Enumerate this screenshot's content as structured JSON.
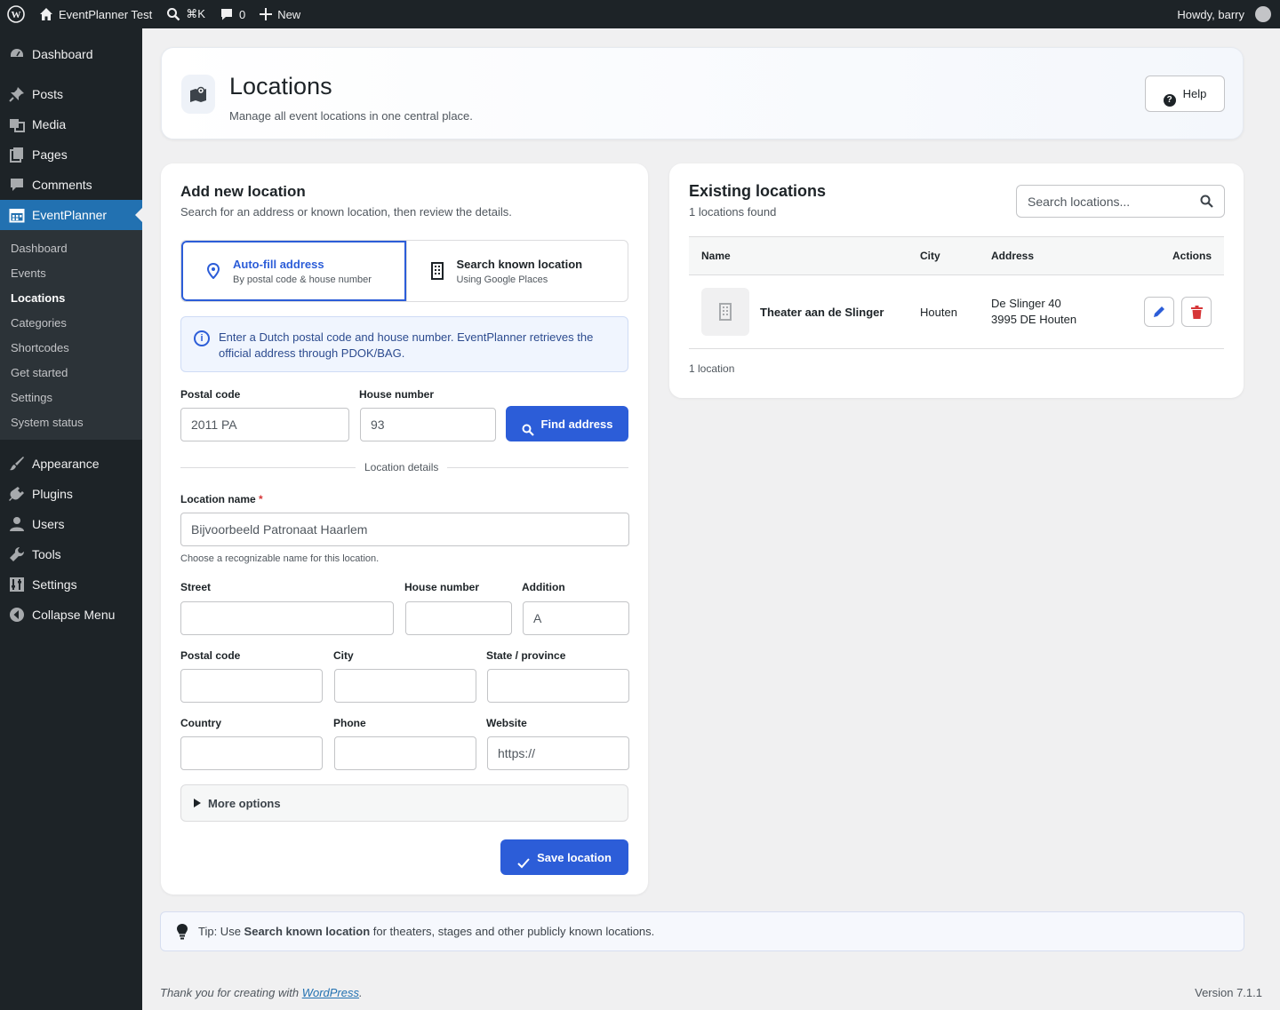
{
  "adminbar": {
    "site_name": "EventPlanner Test",
    "search_shortcut": "⌘K",
    "comments_count": "0",
    "new_label": "New",
    "howdy": "Howdy, barry"
  },
  "sidebar": {
    "top_items": [
      {
        "label": "Dashboard"
      },
      {
        "label": "Posts"
      },
      {
        "label": "Media"
      },
      {
        "label": "Pages"
      },
      {
        "label": "Comments"
      },
      {
        "label": "EventPlanner"
      }
    ],
    "submenu": [
      "Dashboard",
      "Events",
      "Locations",
      "Categories",
      "Shortcodes",
      "Get started",
      "Settings",
      "System status"
    ],
    "bottom_items": [
      {
        "label": "Appearance"
      },
      {
        "label": "Plugins"
      },
      {
        "label": "Users"
      },
      {
        "label": "Tools"
      },
      {
        "label": "Settings"
      },
      {
        "label": "Collapse Menu"
      }
    ]
  },
  "header": {
    "title": "Locations",
    "subtitle": "Manage all event locations in one central place.",
    "help_label": "Help"
  },
  "add_form": {
    "title": "Add new location",
    "subtitle": "Search for an address or known location, then review the details.",
    "tabs": [
      {
        "title": "Auto-fill address",
        "sub": "By postal code & house number"
      },
      {
        "title": "Search known location",
        "sub": "Using Google Places"
      }
    ],
    "info_text": "Enter a Dutch postal code and house number. EventPlanner retrieves the official address through PDOK/BAG.",
    "postal_label": "Postal code",
    "postal_placeholder": "2011 PA",
    "house_label": "House number",
    "house_placeholder": "93",
    "find_label": "Find address",
    "divider_label": "Location details",
    "name_label": "Location name",
    "name_required": "*",
    "name_placeholder": "Bijvoorbeeld Patronaat Haarlem",
    "name_hint": "Choose a recognizable name for this location.",
    "street_label": "Street",
    "house2_label": "House number",
    "addition_label": "Addition",
    "addition_placeholder": "A",
    "postal2_label": "Postal code",
    "city_label": "City",
    "state_label": "State / province",
    "country_label": "Country",
    "phone_label": "Phone",
    "website_label": "Website",
    "website_placeholder": "https://",
    "more_options": "More options",
    "save_label": "Save location"
  },
  "existing": {
    "title": "Existing locations",
    "count_text": "1 locations found",
    "search_placeholder": "Search locations...",
    "columns": [
      "Name",
      "City",
      "Address",
      "Actions"
    ],
    "rows": [
      {
        "name": "Theater aan de Slinger",
        "city": "Houten",
        "address_line1": "De Slinger 40",
        "address_line2": "3995 DE Houten"
      }
    ],
    "footer_count": "1 location"
  },
  "tip": {
    "prefix": "Tip: Use",
    "bold": "Search known location",
    "suffix": "for theaters, stages and other publicly known locations."
  },
  "footer": {
    "thanks": "Thank you for creating with",
    "link": "WordPress",
    "period": ".",
    "version": "Version 7.1.1"
  },
  "colors": {
    "primary": "#2c5dd8",
    "admin_bg": "#1d2327",
    "active_menu": "#2271b1",
    "danger": "#d63638"
  }
}
